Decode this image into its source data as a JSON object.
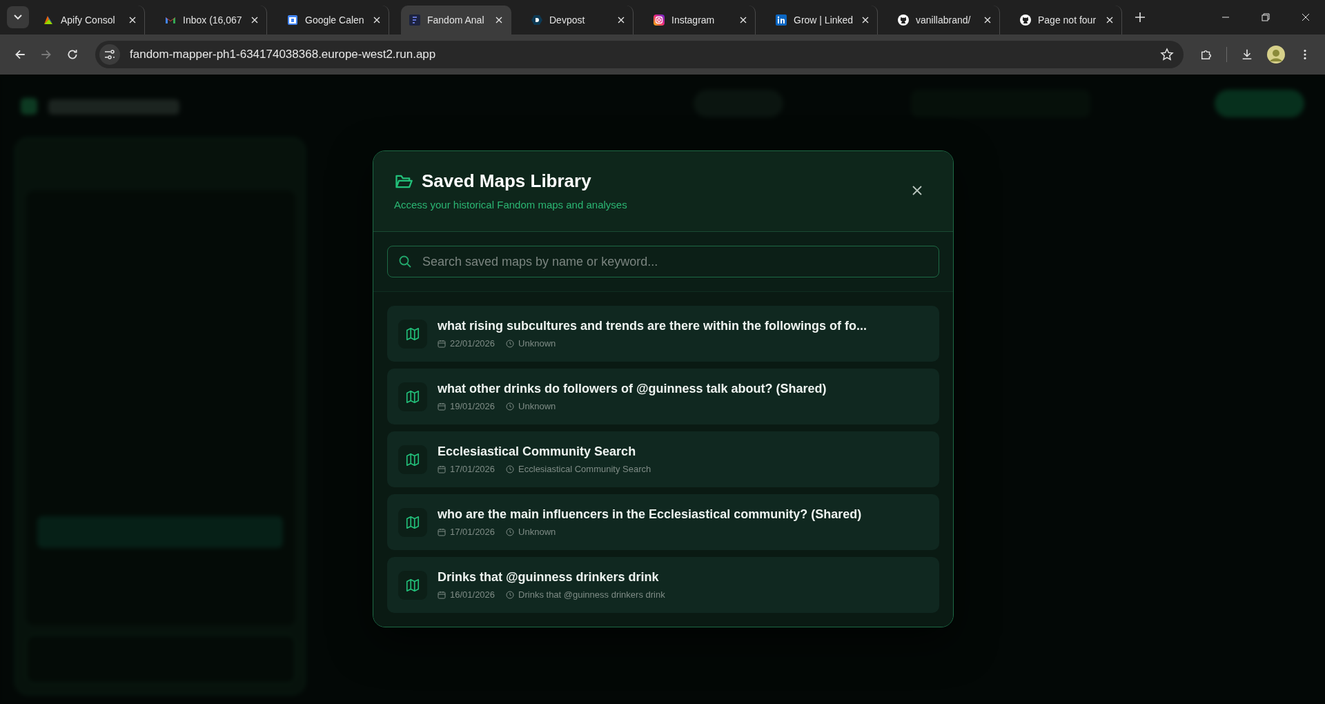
{
  "browser": {
    "tabs": [
      {
        "title": "Apify Consol",
        "kind": "apify",
        "selected": false
      },
      {
        "title": "Inbox (16,067",
        "kind": "gmail",
        "selected": false
      },
      {
        "title": "Google Calen",
        "kind": "calendar",
        "selected": false
      },
      {
        "title": "Fandom Anal",
        "kind": "fandom",
        "selected": true
      },
      {
        "title": "Devpost",
        "kind": "devpost",
        "selected": false
      },
      {
        "title": "Instagram",
        "kind": "instagram",
        "selected": false
      },
      {
        "title": "Grow | Linked",
        "kind": "linkedin",
        "selected": false
      },
      {
        "title": "vanillabrand/",
        "kind": "github",
        "selected": false
      },
      {
        "title": "Page not four",
        "kind": "github",
        "selected": false
      }
    ],
    "url": "fandom-mapper-ph1-634174038368.europe-west2.run.app"
  },
  "modal": {
    "title": "Saved Maps Library",
    "subtitle": "Access your historical Fandom maps and analyses",
    "search": {
      "placeholder": "Search saved maps by name or keyword..."
    },
    "maps": [
      {
        "name": "what rising subcultures and trends are there within the followings of fo...",
        "date": "22/01/2026",
        "source": "Unknown"
      },
      {
        "name": "what other drinks do followers of @guinness talk about? (Shared)",
        "date": "19/01/2026",
        "source": "Unknown"
      },
      {
        "name": "Ecclesiastical Community Search",
        "date": "17/01/2026",
        "source": "Ecclesiastical Community Search"
      },
      {
        "name": "who are the main influencers in the Ecclesiastical community? (Shared)",
        "date": "17/01/2026",
        "source": "Unknown"
      },
      {
        "name": "Drinks that @guinness drinkers drink",
        "date": "16/01/2026",
        "source": "Drinks that @guinness drinkers drink"
      }
    ]
  }
}
